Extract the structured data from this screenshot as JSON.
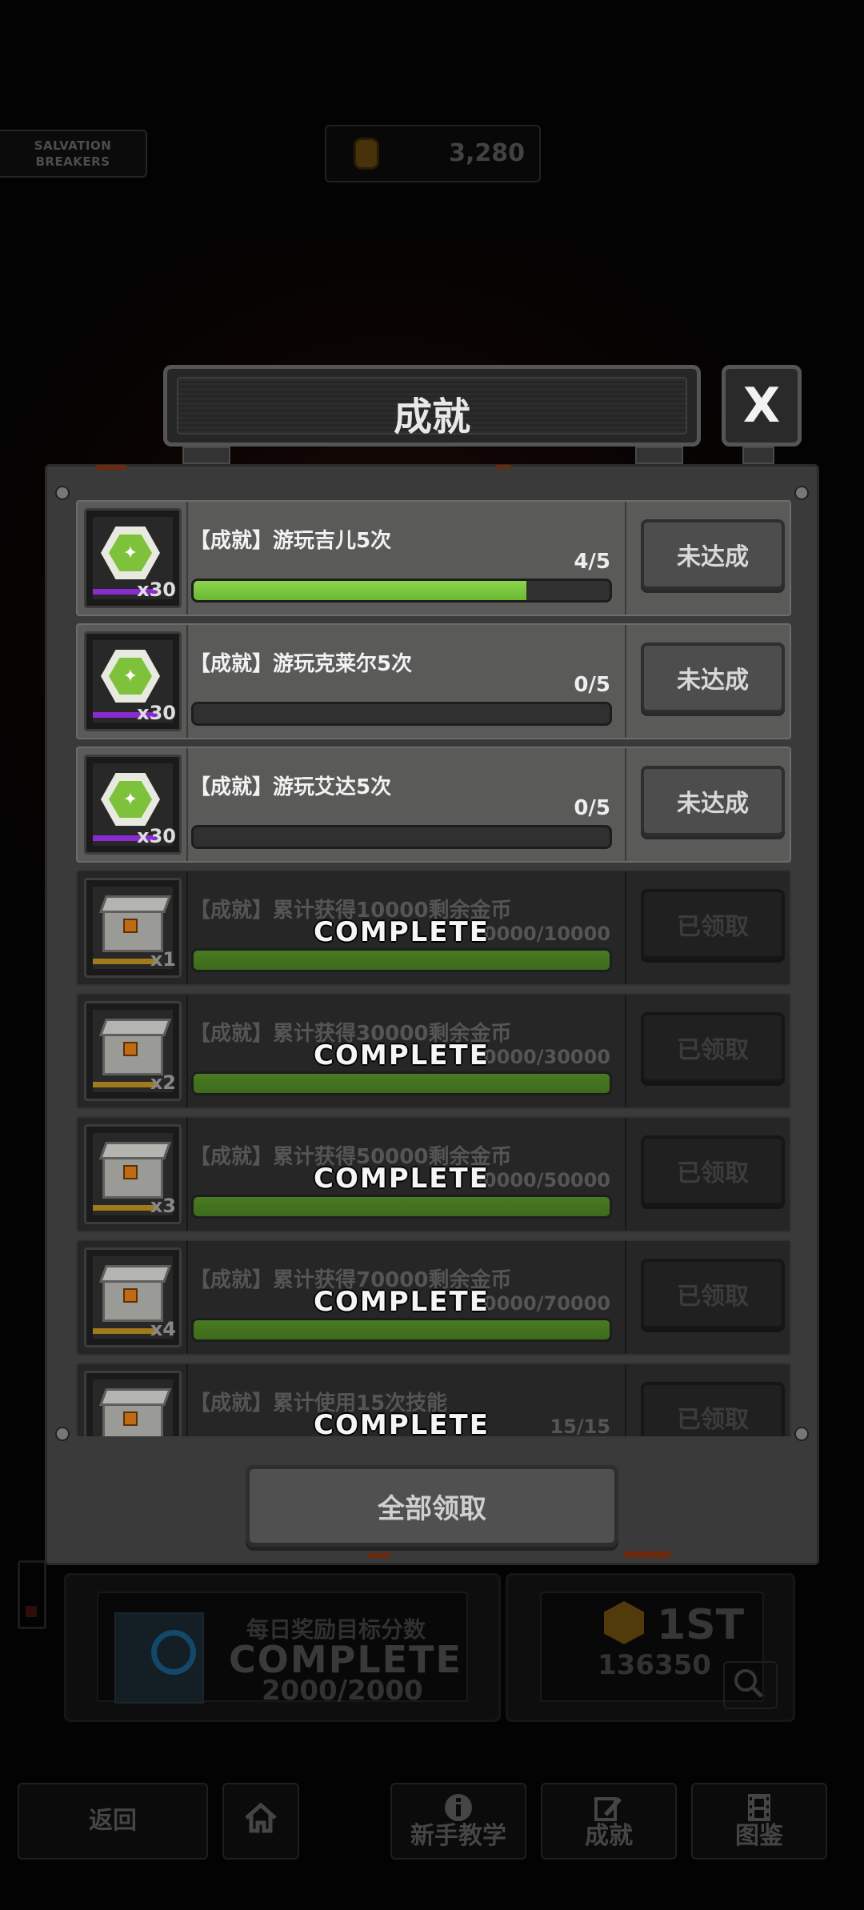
{
  "hud": {
    "team_line1": "SALVATION",
    "team_line2": "BREAKERS",
    "coins": "3,280"
  },
  "dialog": {
    "title": "成就",
    "close_label": "X",
    "claim_all_label": "全部领取",
    "rows": [
      {
        "title": "【成就】游玩吉儿5次",
        "progress": "4/5",
        "fraction": 0.8,
        "qty": "x30",
        "status": "未达成",
        "state": "active",
        "reward": "hex"
      },
      {
        "title": "【成就】游玩克莱尔5次",
        "progress": "0/5",
        "fraction": 0,
        "qty": "x30",
        "status": "未达成",
        "state": "active",
        "reward": "hex"
      },
      {
        "title": "【成就】游玩艾达5次",
        "progress": "0/5",
        "fraction": 0,
        "qty": "x30",
        "status": "未达成",
        "state": "active",
        "reward": "hex"
      },
      {
        "title": "【成就】累计获得10000剩余金币",
        "progress": "10000/10000",
        "fraction": 1,
        "qty": "x1",
        "status": "已领取",
        "state": "done",
        "reward": "crate",
        "overlay": "COMPLETE"
      },
      {
        "title": "【成就】累计获得30000剩余金币",
        "progress": "30000/30000",
        "fraction": 1,
        "qty": "x2",
        "status": "已领取",
        "state": "done",
        "reward": "crate",
        "overlay": "COMPLETE"
      },
      {
        "title": "【成就】累计获得50000剩余金币",
        "progress": "50000/50000",
        "fraction": 1,
        "qty": "x3",
        "status": "已领取",
        "state": "done",
        "reward": "crate",
        "overlay": "COMPLETE"
      },
      {
        "title": "【成就】累计获得70000剩余金币",
        "progress": "70000/70000",
        "fraction": 1,
        "qty": "x4",
        "status": "已领取",
        "state": "done",
        "reward": "crate",
        "overlay": "COMPLETE"
      },
      {
        "title": "【成就】累计使用15次技能",
        "progress": "15/15",
        "fraction": 1,
        "qty": "",
        "status": "已领取",
        "state": "done",
        "reward": "crate",
        "overlay": "COMPLETE"
      }
    ]
  },
  "background": {
    "daily_title": "每日奖励目标分数",
    "daily_complete": "COMPLETE",
    "daily_score": "2000/2000",
    "rank": "1ST",
    "rank_score": "136350"
  },
  "nav": {
    "back": "返回",
    "tutorial": "新手教学",
    "achievements": "成就",
    "gallery": "图鉴"
  }
}
